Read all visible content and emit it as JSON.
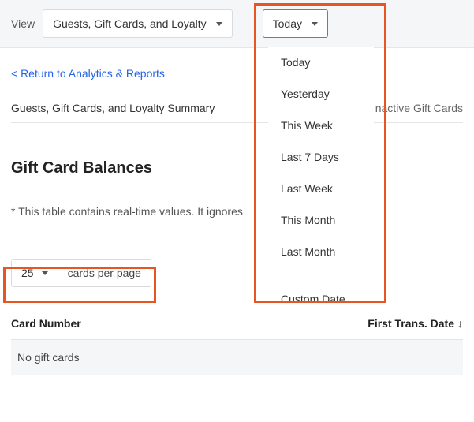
{
  "topbar": {
    "view_label": "View",
    "view_select_value": "Guests, Gift Cards, and Loyalty",
    "date_select_value": "Today"
  },
  "back_link": "< Return to Analytics & Reports",
  "tabs": {
    "summary": "Guests, Gift Cards, and Loyalty Summary",
    "inactive": "nactive Gift Cards"
  },
  "section_title": "Gift Card Balances",
  "note": "* This table contains real-time values. It ignores",
  "page_size": {
    "value": "25",
    "label": "cards per page"
  },
  "table": {
    "col_card_number": "Card Number",
    "col_first_trans": "First Trans. Date",
    "empty": "No gift cards"
  },
  "dropdown_items": [
    "Today",
    "Yesterday",
    "This Week",
    "Last 7 Days",
    "Last Week",
    "This Month",
    "Last Month"
  ],
  "dropdown_custom": "Custom Date"
}
